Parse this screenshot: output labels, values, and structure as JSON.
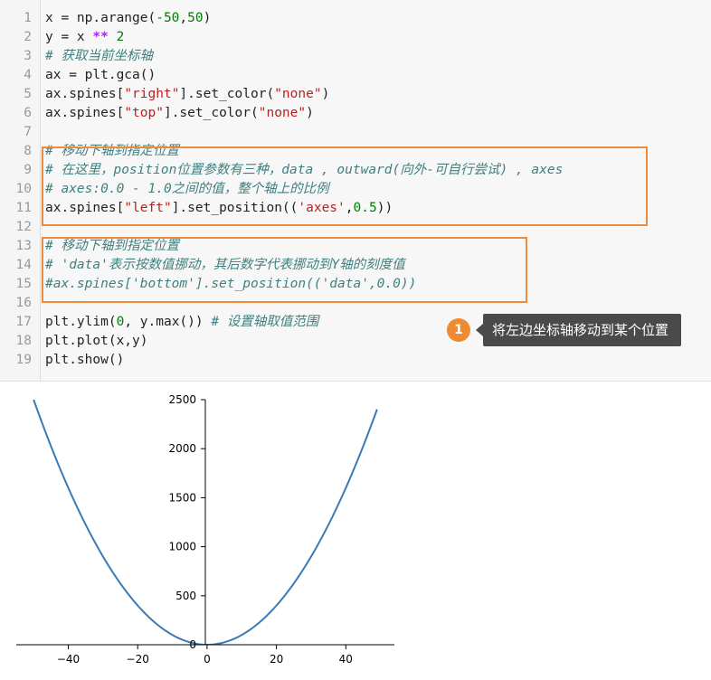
{
  "code_lines": [
    {
      "n": "1",
      "parts": [
        [
          "",
          "x = np.arange("
        ],
        [
          "num",
          "-50"
        ],
        [
          "",
          ","
        ],
        [
          "num",
          "50"
        ],
        [
          "",
          ")"
        ]
      ]
    },
    {
      "n": "2",
      "parts": [
        [
          "",
          "y = x "
        ],
        [
          "op",
          "**"
        ],
        [
          "",
          " "
        ],
        [
          "num",
          "2"
        ]
      ]
    },
    {
      "n": "3",
      "parts": [
        [
          "cm",
          "# 获取当前坐标轴"
        ]
      ]
    },
    {
      "n": "4",
      "parts": [
        [
          "",
          "ax = plt.gca()"
        ]
      ]
    },
    {
      "n": "5",
      "parts": [
        [
          "",
          "ax.spines["
        ],
        [
          "str",
          "\"right\""
        ],
        [
          "",
          "].set_color("
        ],
        [
          "str",
          "\"none\""
        ],
        [
          "",
          ")"
        ]
      ]
    },
    {
      "n": "6",
      "parts": [
        [
          "",
          "ax.spines["
        ],
        [
          "str",
          "\"top\""
        ],
        [
          "",
          "].set_color("
        ],
        [
          "str",
          "\"none\""
        ],
        [
          "",
          ")"
        ]
      ]
    },
    {
      "n": "7",
      "parts": []
    },
    {
      "n": "8",
      "parts": [
        [
          "cm",
          "# 移动下轴到指定位置"
        ]
      ]
    },
    {
      "n": "9",
      "parts": [
        [
          "cm",
          "# 在这里，position位置参数有三种，data , outward(向外-可自行尝试) , axes"
        ]
      ]
    },
    {
      "n": "10",
      "parts": [
        [
          "cm",
          "# axes:0.0 - 1.0之间的值，整个轴上的比例"
        ]
      ]
    },
    {
      "n": "11",
      "parts": [
        [
          "",
          "ax.spines["
        ],
        [
          "str",
          "\"left\""
        ],
        [
          "",
          "].set_position(("
        ],
        [
          "str",
          "'axes'"
        ],
        [
          "",
          ","
        ],
        [
          "num",
          "0.5"
        ],
        [
          "",
          "))"
        ]
      ]
    },
    {
      "n": "12",
      "parts": []
    },
    {
      "n": "13",
      "parts": [
        [
          "cm",
          "# 移动下轴到指定位置"
        ]
      ]
    },
    {
      "n": "14",
      "parts": [
        [
          "cm",
          "# 'data'表示按数值挪动，其后数字代表挪动到Y轴的刻度值"
        ]
      ]
    },
    {
      "n": "15",
      "parts": [
        [
          "cm",
          "#ax.spines['bottom'].set_position(('data',0.0))"
        ]
      ]
    },
    {
      "n": "16",
      "parts": []
    },
    {
      "n": "17",
      "parts": [
        [
          "",
          "plt.ylim("
        ],
        [
          "num",
          "0"
        ],
        [
          "",
          ", y.max()) "
        ],
        [
          "cm",
          "# 设置轴取值范围"
        ]
      ]
    },
    {
      "n": "18",
      "parts": [
        [
          "",
          "plt.plot(x,y)"
        ]
      ]
    },
    {
      "n": "19",
      "parts": [
        [
          "",
          "plt.show()"
        ]
      ]
    }
  ],
  "annotation": {
    "badge": "1",
    "text": "将左边坐标轴移动到某个位置"
  },
  "colors": {
    "highlight_box": "#ee8a3c",
    "line": "#3a7ab5",
    "badge": "#f08a30",
    "bubble": "#4a4a4a"
  },
  "chart_data": {
    "type": "line",
    "function": "y = x ** 2",
    "x_range": [
      -50,
      49
    ],
    "xlim": [
      -55,
      54
    ],
    "ylim": [
      0,
      2500
    ],
    "xticks": [
      -40,
      -20,
      0,
      20,
      40
    ],
    "xtick_labels": [
      "−40",
      "−20",
      "0",
      "20",
      "40"
    ],
    "yticks": [
      0,
      500,
      1000,
      1500,
      2000,
      2500
    ],
    "ytick_labels": [
      "0",
      "500",
      "1000",
      "1500",
      "2000",
      "2500"
    ],
    "left_spine": "center",
    "top_right_spines": "none",
    "grid": false
  }
}
